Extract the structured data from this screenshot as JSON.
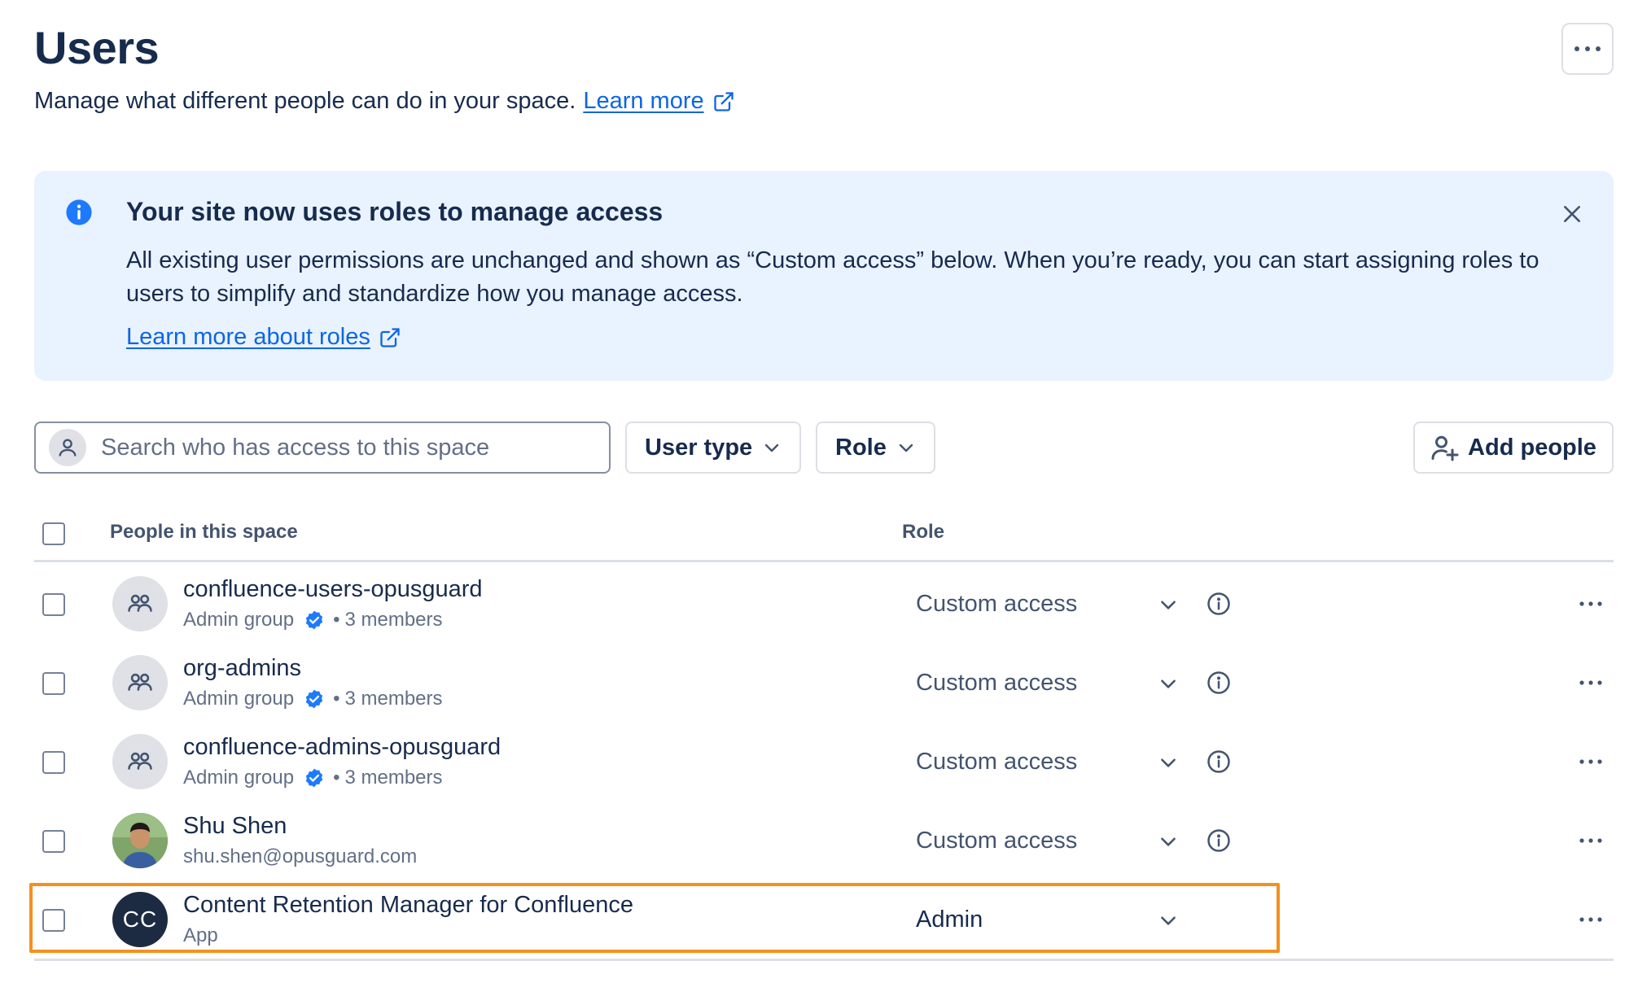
{
  "header": {
    "title": "Users",
    "subtitle": "Manage what different people can do in your space.",
    "learn_more": "Learn more",
    "more_icon": "more-horizontal-icon"
  },
  "banner": {
    "title": "Your site now uses roles to manage access",
    "body": "All existing user permissions are unchanged and shown as “Custom access” below. When you’re ready, you can start assigning roles to users to simplify and standardize how you manage access.",
    "link": "Learn more about roles",
    "info_icon": "info-icon",
    "close_icon": "close-icon",
    "background": "#e9f2ff"
  },
  "toolbar": {
    "search_placeholder": "Search who has access to this space",
    "user_type_label": "User type",
    "role_label": "Role",
    "add_people_label": "Add people"
  },
  "table": {
    "columns": [
      "People in this space",
      "Role"
    ],
    "rows": [
      {
        "name": "confluence-users-opusguard",
        "type": "Admin group",
        "members": "3 members",
        "role": "Custom access",
        "avatar": "group-icon"
      },
      {
        "name": "org-admins",
        "type": "Admin group",
        "members": "3 members",
        "role": "Custom access",
        "avatar": "group-icon"
      },
      {
        "name": "confluence-admins-opusguard",
        "type": "Admin group",
        "members": "3 members",
        "role": "Custom access",
        "avatar": "group-icon"
      },
      {
        "name": "Shu Shen",
        "email": "shu.shen@opusguard.com",
        "role": "Custom access",
        "avatar": "user-photo"
      },
      {
        "name": "Content Retention Manager for Confluence",
        "type": "App",
        "initials": "CC",
        "role": "Admin",
        "avatar": "app-initials",
        "highlighted": true
      }
    ]
  },
  "colors": {
    "link": "#0c66e4",
    "verified": "#1d7afc",
    "highlight": "#f5901f",
    "app_avatar": "#1c2b42"
  }
}
